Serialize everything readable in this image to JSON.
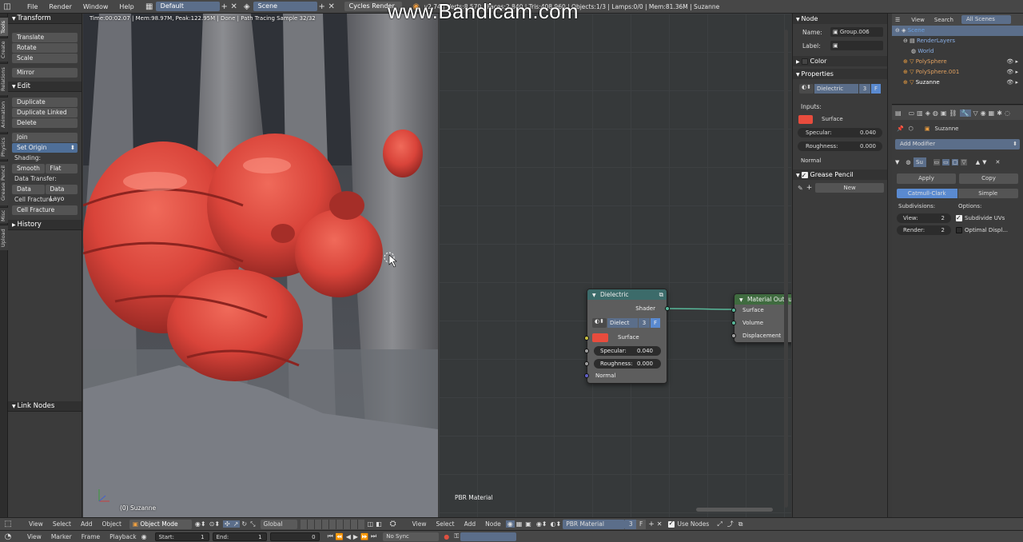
{
  "topbar": {
    "menus": [
      "File",
      "Render",
      "Window",
      "Help"
    ],
    "layout": "Default",
    "scene": "Scene",
    "engine": "Cycles Render",
    "stats": "v2.74 | Verts:8,570 | Faces:2,840 | Tris:408,960 | Objects:1/3 | Lamps:0/0 | Mem:81.36M | Suzanne"
  },
  "watermark": "www.Bandicam.com",
  "vtabs": [
    "Tools",
    "Create",
    "Relations",
    "Animation",
    "Physics",
    "Grease Pencil",
    "Misc",
    "Upload"
  ],
  "toolshelf": {
    "transform_head": "Transform",
    "translate": "Translate",
    "rotate": "Rotate",
    "scale": "Scale",
    "mirror": "Mirror",
    "edit_head": "Edit",
    "duplicate": "Duplicate",
    "duplicate_linked": "Duplicate Linked",
    "delete": "Delete",
    "join": "Join",
    "set_origin": "Set Origin",
    "shading_label": "Shading:",
    "smooth": "Smooth",
    "flat": "Flat",
    "data_transfer_label": "Data Transfer:",
    "data": "Data",
    "data_layo": "Data Layo",
    "cell_fracture_label": "Cell Fracture:",
    "cell_fracture": "Cell Fracture",
    "history_head": "History",
    "link_nodes_head": "Link Nodes"
  },
  "viewport": {
    "info": "Time:00:02.07 | Mem:98.97M, Peak:122.95M | Done | Path Tracing Sample 32/32",
    "object": "(0) Suzanne"
  },
  "node_editor": {
    "dielectric": {
      "title": "Dielectric",
      "shader_out": "Shader",
      "group_name": "Dielect",
      "users": "3",
      "fake": "F",
      "surface": "Surface",
      "specular_label": "Specular:",
      "specular_value": "0.040",
      "roughness_label": "Roughness:",
      "roughness_value": "0.000",
      "normal": "Normal",
      "surface_color": "#e84c3d"
    },
    "material_output": {
      "title": "Material Outpu",
      "surface": "Surface",
      "volume": "Volume",
      "displacement": "Displacement"
    },
    "material_label": "PBR Material"
  },
  "npanel": {
    "node_head": "Node",
    "name_label": "Name:",
    "name_value": "Group.006",
    "label_label": "Label:",
    "label_value": "",
    "color_head": "Color",
    "properties_head": "Properties",
    "group": "Dielectric",
    "users": "3",
    "fake": "F",
    "inputs_label": "Inputs:",
    "surface": "Surface",
    "specular_label": "Specular:",
    "specular_value": "0.040",
    "roughness_label": "Roughness:",
    "roughness_value": "0.000",
    "normal": "Normal",
    "grease_head": "Grease Pencil",
    "new_button": "New"
  },
  "outliner": {
    "view": "View",
    "search": "Search",
    "filter": "All Scenes",
    "items": [
      "Scene",
      "RenderLayers",
      "World",
      "PolySphere",
      "PolySphere.001",
      "Suzanne"
    ]
  },
  "properties": {
    "object": "Suzanne",
    "add_modifier": "Add Modifier",
    "modifier_name": "Su",
    "apply": "Apply",
    "copy": "Copy",
    "catmull": "Catmull-Clark",
    "simple": "Simple",
    "subdivisions_label": "Subdivisions:",
    "options_label": "Options:",
    "view_label": "View:",
    "view_value": "2",
    "render_label": "Render:",
    "render_value": "2",
    "subdivide_uvs": "Subdivide UVs",
    "optimal_display": "Optimal Displ..."
  },
  "bottombar": {
    "view": "View",
    "select": "Select",
    "add": "Add",
    "object": "Object",
    "mode": "Object Mode",
    "global": "Global",
    "node_view": "View",
    "node_select": "Select",
    "node_add": "Add",
    "node_node": "Node",
    "material": "PBR Material",
    "mat_users": "3",
    "mat_fake": "F",
    "use_nodes": "Use Nodes"
  },
  "timeline": {
    "view": "View",
    "marker": "Marker",
    "frame": "Frame",
    "playback": "Playback",
    "start_label": "Start:",
    "start_value": "1",
    "end_label": "End:",
    "end_value": "1",
    "current": "0",
    "sync": "No Sync"
  }
}
